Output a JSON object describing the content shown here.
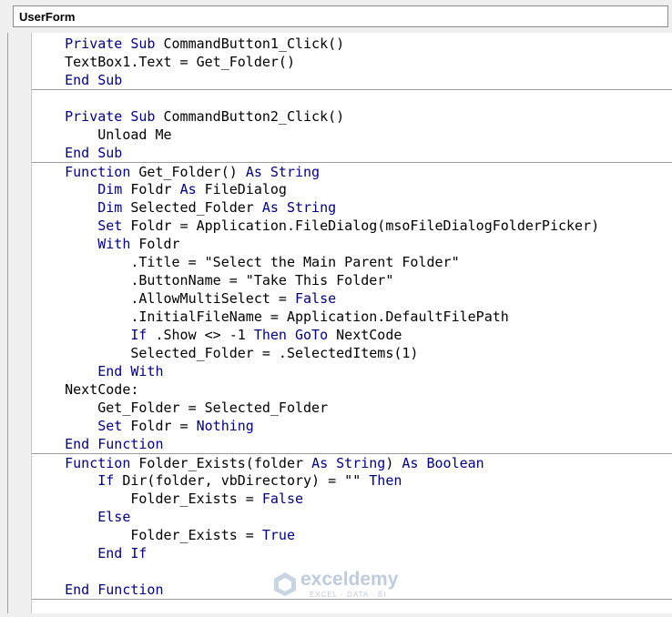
{
  "window": {
    "object_name": "UserForm"
  },
  "code_lines": [
    [
      {
        "t": "    "
      },
      {
        "t": "Private Sub",
        "k": 1
      },
      {
        "t": " CommandButton1_Click()"
      }
    ],
    [
      {
        "t": "    TextBox1.Text = Get_Folder()"
      }
    ],
    [
      {
        "t": "    "
      },
      {
        "t": "End Sub",
        "k": 1
      }
    ],
    [
      {
        "t": ""
      }
    ],
    [
      {
        "t": "    "
      },
      {
        "t": "Private Sub",
        "k": 1
      },
      {
        "t": " CommandButton2_Click()"
      }
    ],
    [
      {
        "t": "        Unload Me"
      }
    ],
    [
      {
        "t": "    "
      },
      {
        "t": "End Sub",
        "k": 1
      }
    ],
    [
      {
        "t": "    "
      },
      {
        "t": "Function",
        "k": 1
      },
      {
        "t": " Get_Folder() "
      },
      {
        "t": "As String",
        "k": 1
      }
    ],
    [
      {
        "t": "        "
      },
      {
        "t": "Dim",
        "k": 1
      },
      {
        "t": " Foldr "
      },
      {
        "t": "As",
        "k": 1
      },
      {
        "t": " FileDialog"
      }
    ],
    [
      {
        "t": "        "
      },
      {
        "t": "Dim",
        "k": 1
      },
      {
        "t": " Selected_Folder "
      },
      {
        "t": "As String",
        "k": 1
      }
    ],
    [
      {
        "t": "        "
      },
      {
        "t": "Set",
        "k": 1
      },
      {
        "t": " Foldr = Application.FileDialog(msoFileDialogFolderPicker)"
      }
    ],
    [
      {
        "t": "        "
      },
      {
        "t": "With",
        "k": 1
      },
      {
        "t": " Foldr"
      }
    ],
    [
      {
        "t": "            .Title = \"Select the Main Parent Folder\""
      }
    ],
    [
      {
        "t": "            .ButtonName = \"Take This Folder\""
      }
    ],
    [
      {
        "t": "            .AllowMultiSelect = "
      },
      {
        "t": "False",
        "k": 1
      }
    ],
    [
      {
        "t": "            .InitialFileName = Application.DefaultFilePath"
      }
    ],
    [
      {
        "t": "            "
      },
      {
        "t": "If",
        "k": 1
      },
      {
        "t": " .Show <> -1 "
      },
      {
        "t": "Then GoTo",
        "k": 1
      },
      {
        "t": " NextCode"
      }
    ],
    [
      {
        "t": "            Selected_Folder = .SelectedItems(1)"
      }
    ],
    [
      {
        "t": "        "
      },
      {
        "t": "End With",
        "k": 1
      }
    ],
    [
      {
        "t": "    NextCode:"
      }
    ],
    [
      {
        "t": "        Get_Folder = Selected_Folder"
      }
    ],
    [
      {
        "t": "        "
      },
      {
        "t": "Set",
        "k": 1
      },
      {
        "t": " Foldr = "
      },
      {
        "t": "Nothing",
        "k": 1
      }
    ],
    [
      {
        "t": "    "
      },
      {
        "t": "End Function",
        "k": 1
      }
    ],
    [
      {
        "t": "    "
      },
      {
        "t": "Function",
        "k": 1
      },
      {
        "t": " Folder_Exists(folder "
      },
      {
        "t": "As String",
        "k": 1
      },
      {
        "t": ") "
      },
      {
        "t": "As Boolean",
        "k": 1
      }
    ],
    [
      {
        "t": "        "
      },
      {
        "t": "If",
        "k": 1
      },
      {
        "t": " Dir(folder, vbDirectory) = \"\" "
      },
      {
        "t": "Then",
        "k": 1
      }
    ],
    [
      {
        "t": "            Folder_Exists = "
      },
      {
        "t": "False",
        "k": 1
      }
    ],
    [
      {
        "t": "        "
      },
      {
        "t": "Else",
        "k": 1
      }
    ],
    [
      {
        "t": "            Folder_Exists = "
      },
      {
        "t": "True",
        "k": 1
      }
    ],
    [
      {
        "t": "        "
      },
      {
        "t": "End If",
        "k": 1
      }
    ],
    [
      {
        "t": ""
      }
    ],
    [
      {
        "t": "    "
      },
      {
        "t": "End Function",
        "k": 1
      }
    ],
    [
      {
        "t": ""
      }
    ]
  ],
  "separator_lines": [
    3,
    7,
    23,
    31
  ],
  "colors": {
    "keyword": "#00007f",
    "text": "#000000",
    "background": "#ffffff"
  },
  "watermark": {
    "brand": "exceldemy",
    "tagline": "EXCEL · DATA · BI",
    "icon": "exceldemy-logo-icon"
  }
}
